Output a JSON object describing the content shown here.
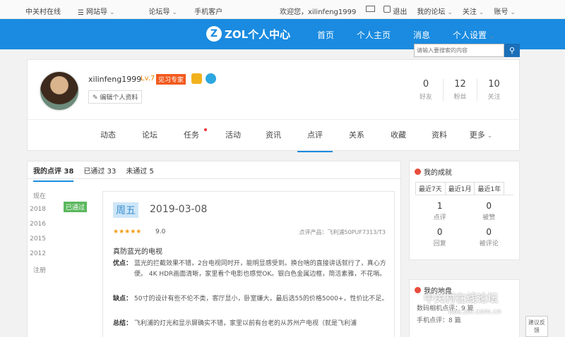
{
  "topbar": {
    "left": [
      "中关村在线",
      "网站导",
      "论坛导",
      "手机客户"
    ],
    "welcome": "欢迎您，xilinfeng1999",
    "exit": "退出",
    "my_forum": "我的论坛",
    "follow": "关注",
    "account": "账号"
  },
  "header": {
    "logo": "ZOL个人中心",
    "nav": [
      "首页",
      "个人主页",
      "消息",
      "个人设置"
    ],
    "search_placeholder": "请输入要搜索的内容"
  },
  "profile": {
    "username": "xilinfeng1999",
    "level": "Lv.7",
    "title_tag": "见习专家",
    "edit": "编辑个人资料",
    "stats": [
      {
        "value": "0",
        "label": "好友"
      },
      {
        "value": "12",
        "label": "粉丝"
      },
      {
        "value": "10",
        "label": "关注"
      }
    ],
    "tabs": [
      "动态",
      "论坛",
      "任务",
      "活动",
      "资讯",
      "点评",
      "关系",
      "收藏",
      "资料",
      "更多"
    ]
  },
  "reviews": {
    "subtabs": [
      "我的点评 38",
      "已通过 33",
      "未通过 5"
    ],
    "timeline": [
      "现在",
      "2018",
      "2016",
      "2015",
      "2012",
      "注册"
    ],
    "status": "已通过",
    "day": "周五",
    "date": "2019-03-08",
    "stars": "★★★★★",
    "score": "9.0",
    "product": "点评产品：飞利浦50PUF7313/T3",
    "title": "真防蓝光的电视",
    "pros_label": "优点：",
    "pros": "蓝光的拦截效果不错，2台电视同时开，能明显感受到。换台啥的直接讲话就行了，真心方便。 4K HDR画面清晰，家里看个电影也感觉OK。银白色金属边框，简洁素雅，不花哨。",
    "cons_label": "缺点：",
    "cons": "50寸的设计有些不伦不类，客厅显小，卧室嫌大，最后选55的价格5000+，性价比不足。",
    "summary_label": "总结：",
    "summary": "飞利浦的灯光和显示屏确实不错，家里以前有台老的从苏州产电视（就是飞利浦"
  },
  "sidebar": {
    "achievements_title": "我的成就",
    "ranges": [
      "最近7天",
      "最近1月",
      "最近1年"
    ],
    "achievements": [
      {
        "value": "1",
        "label": "点评"
      },
      {
        "value": "0",
        "label": "被赞"
      },
      {
        "value": "0",
        "label": "回复"
      },
      {
        "value": "0",
        "label": "被评论"
      }
    ],
    "area_title": "我的地盘",
    "area_rows": [
      "数码相机点评：9 篇",
      "手机点评：8 篇"
    ]
  },
  "watermark": {
    "main": "中关村在线论坛",
    "sub": "bbs.zol.com.cn"
  },
  "feedback": "建议反馈"
}
